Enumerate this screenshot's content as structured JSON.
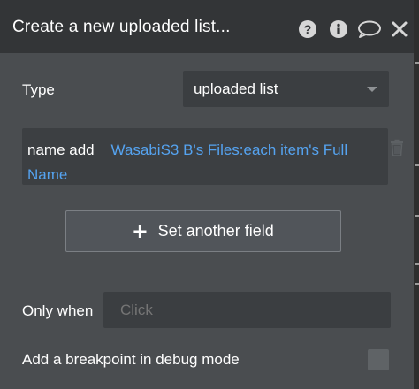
{
  "header": {
    "title": "Create a new uploaded list...",
    "icons": [
      "help-icon",
      "info-icon",
      "comment-icon",
      "close-icon"
    ]
  },
  "type_row": {
    "label": "Type",
    "selected": "uploaded list"
  },
  "field": {
    "name": "name add",
    "expression": "WasabiS3 B's Files:each item's Full Name"
  },
  "actions": {
    "set_field_label": "Set another field"
  },
  "condition": {
    "label": "Only when",
    "placeholder": "Click"
  },
  "debug": {
    "label": "Add a breakpoint in debug mode",
    "checked": false
  },
  "colors": {
    "panel_bg": "#4a4d50",
    "header_bg": "#333537",
    "expression_blue": "#55a3f0"
  }
}
